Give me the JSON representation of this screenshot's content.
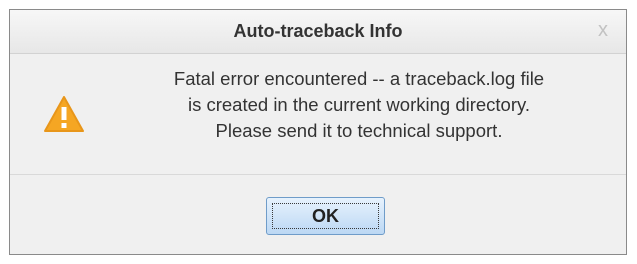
{
  "dialog": {
    "title": "Auto-traceback Info",
    "close_label": "x",
    "message_lines": [
      "Fatal error encountered -- a traceback.log file",
      "is created in the current working directory.",
      "Please send it to technical support."
    ],
    "icon": "warning-icon",
    "ok_label": "OK"
  },
  "colors": {
    "warning_fill": "#f5a623",
    "button_border": "#6f9cc9"
  }
}
